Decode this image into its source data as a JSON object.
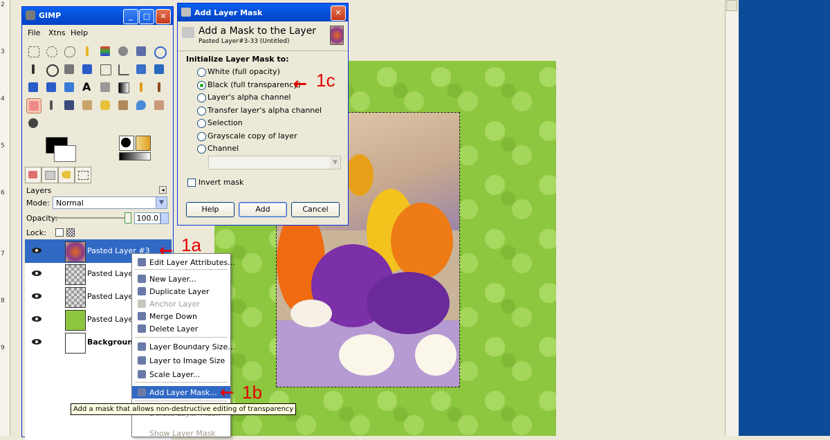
{
  "ruler": {
    "numbers": [
      "2",
      "3",
      "4",
      "5",
      "6",
      "7",
      "8",
      "9"
    ]
  },
  "gimp": {
    "title": "GIMP",
    "menu": [
      "File",
      "Xtns",
      "Help"
    ],
    "layers_panel": {
      "tab_label": "Layers",
      "mode_label": "Mode:",
      "mode_value": "Normal",
      "opacity_label": "Opacity:",
      "opacity_value": "100.0",
      "opacity_fraction": 1.0,
      "lock_label": "Lock:"
    },
    "layers": [
      {
        "name": "Pasted Layer #3",
        "thumb": "photo",
        "selected": true
      },
      {
        "name": "Pasted Layer",
        "thumb": "checker",
        "selected": false
      },
      {
        "name": "Pasted Layer",
        "thumb": "checker",
        "selected": false
      },
      {
        "name": "Pasted Layer",
        "thumb": "green",
        "selected": false
      },
      {
        "name": "Background",
        "thumb": "white",
        "selected": false
      }
    ]
  },
  "context_menu": {
    "items": [
      {
        "label": "Edit Layer Attributes...",
        "disabled": false,
        "icon": "edit-icon"
      },
      {
        "label": "New Layer...",
        "disabled": false,
        "icon": "new-layer-icon"
      },
      {
        "label": "Duplicate Layer",
        "disabled": false,
        "icon": "duplicate-icon"
      },
      {
        "label": "Anchor Layer",
        "disabled": true,
        "icon": "anchor-icon"
      },
      {
        "label": "Merge Down",
        "disabled": false,
        "icon": "merge-icon"
      },
      {
        "label": "Delete Layer",
        "disabled": false,
        "icon": "trash-icon"
      },
      {
        "label": "Layer Boundary Size...",
        "disabled": false,
        "icon": "boundary-icon"
      },
      {
        "label": "Layer to Image Size",
        "disabled": false,
        "icon": "fit-icon"
      },
      {
        "label": "Scale Layer...",
        "disabled": false,
        "icon": "scale-icon"
      },
      {
        "label": "Add Layer Mask...",
        "disabled": false,
        "icon": "mask-icon",
        "highlighted": true
      },
      {
        "label": "Delete Layer Mask",
        "disabled": true,
        "icon": ""
      },
      {
        "label": "Show Layer Mask",
        "disabled": true,
        "icon": ""
      }
    ]
  },
  "tooltip": "Add a mask that allows non-destructive editing of transparency",
  "dialog": {
    "title": "Add Layer Mask",
    "heading": "Add a Mask to the Layer",
    "subheading": "Pasted Layer#3-33 (Untitled)",
    "section": "Initialize Layer Mask to:",
    "options": [
      {
        "label": "White (full opacity)",
        "checked": false
      },
      {
        "label": "Black (full transparency)",
        "checked": true
      },
      {
        "label": "Layer's alpha channel",
        "checked": false
      },
      {
        "label": "Transfer layer's alpha channel",
        "checked": false
      },
      {
        "label": "Selection",
        "checked": false
      },
      {
        "label": "Grayscale copy of layer",
        "checked": false
      },
      {
        "label": "Channel",
        "checked": false
      }
    ],
    "invert_label": "Invert mask",
    "buttons": {
      "help": "Help",
      "add": "Add",
      "cancel": "Cancel"
    }
  },
  "annotations": {
    "a": "1a",
    "b": "1b",
    "c": "1c"
  },
  "colors": {
    "title_blue": "#0550d6",
    "selection": "#316ac5",
    "annotation_red": "#e30000",
    "paper_green": "#8dc63f"
  }
}
